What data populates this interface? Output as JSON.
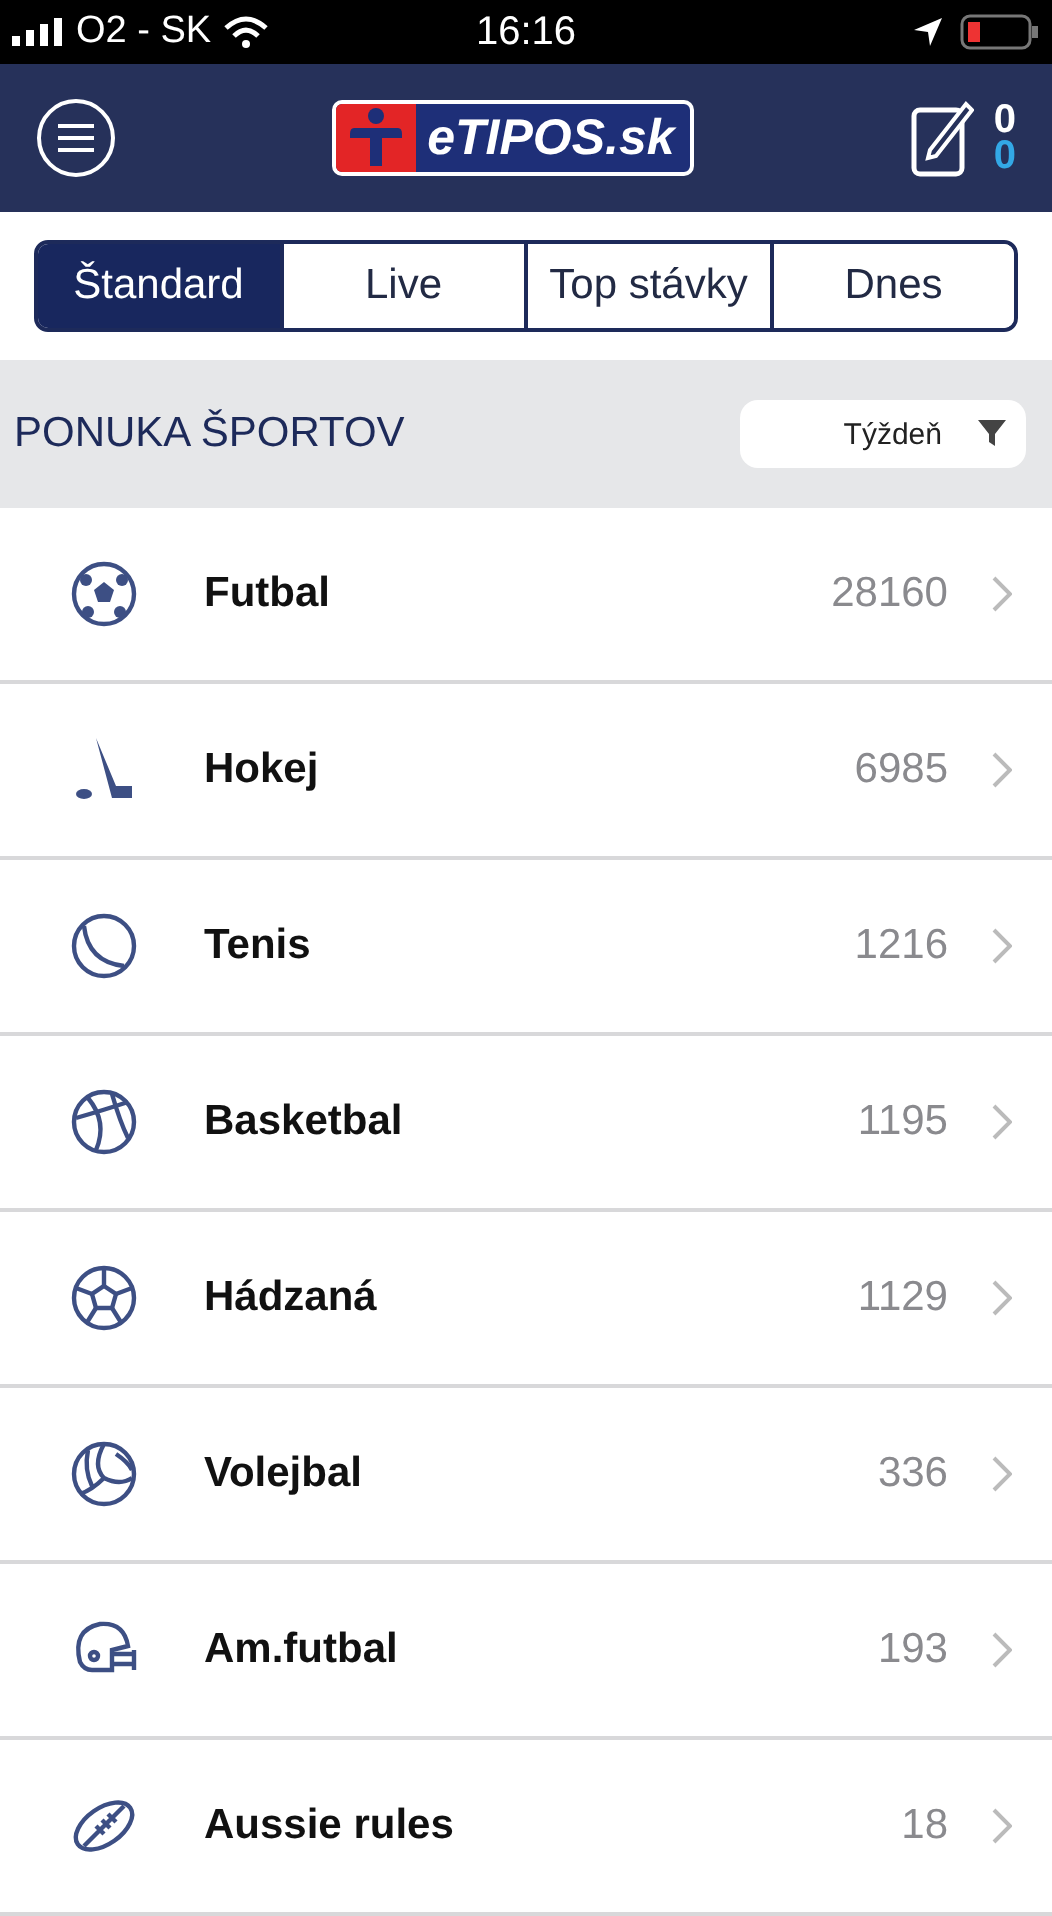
{
  "status_bar": {
    "carrier": "O2 - SK",
    "time": "16:16"
  },
  "header": {
    "logo_text": "eTIPOS.sk",
    "ticket_count": "0",
    "ticket_count_live": "0"
  },
  "tabs": [
    {
      "label": "Štandard",
      "selected": true
    },
    {
      "label": "Live",
      "selected": false
    },
    {
      "label": "Top stávky",
      "selected": false
    },
    {
      "label": "Dnes",
      "selected": false
    }
  ],
  "section": {
    "title": "PONUKA ŠPORTOV",
    "filter": "Týždeň"
  },
  "sports": [
    {
      "kind": "soccer",
      "name": "Futbal",
      "count": "28160"
    },
    {
      "kind": "hockey",
      "name": "Hokej",
      "count": "6985"
    },
    {
      "kind": "tennis",
      "name": "Tenis",
      "count": "1216"
    },
    {
      "kind": "basketball",
      "name": "Basketbal",
      "count": "1195"
    },
    {
      "kind": "handball",
      "name": "Hádzaná",
      "count": "1129"
    },
    {
      "kind": "volleyball",
      "name": "Volejbal",
      "count": "336"
    },
    {
      "kind": "helmet",
      "name": "Am.futbal",
      "count": "193"
    },
    {
      "kind": "rugby",
      "name": "Aussie rules",
      "count": "18"
    }
  ]
}
